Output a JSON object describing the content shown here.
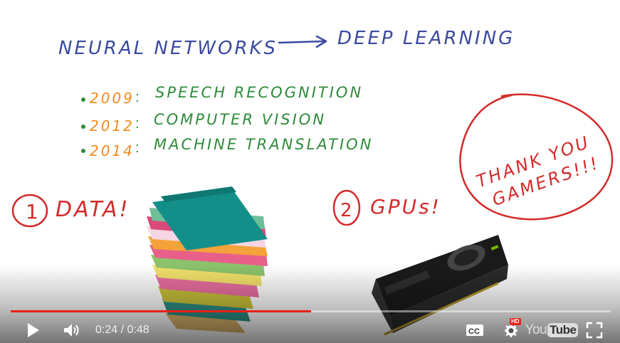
{
  "slide": {
    "heading_left": "NEURAL NETWORKS",
    "heading_right": "DEEP LEARNING",
    "milestones": [
      {
        "year": "2009",
        "label": "SPEECH RECOGNITION"
      },
      {
        "year": "2012",
        "label": "COMPUTER VISION"
      },
      {
        "year": "2014",
        "label": "MACHINE TRANSLATION"
      }
    ],
    "reason1": {
      "number": "1",
      "label": "DATA!"
    },
    "reason2": {
      "number": "2",
      "label": "GPUs!"
    },
    "bubble_line1": "THANK YOU",
    "bubble_line2": "GAMERS!!!"
  },
  "player": {
    "current_time": "0:24",
    "separator": "/",
    "duration": "0:48",
    "progress_fraction": 0.5,
    "hd_badge": "HD",
    "logo_you": "You",
    "logo_tube": "Tube",
    "cc_label": "CC"
  },
  "colors": {
    "ink_blue": "#3b4aa0",
    "ink_green": "#2e8b3a",
    "ink_orange": "#f08a1e",
    "ink_red": "#d42a2a",
    "progress_red": "#e62117"
  },
  "icons": [
    "play-icon",
    "volume-icon",
    "cc-icon",
    "settings-icon",
    "youtube-logo",
    "fullscreen-icon"
  ]
}
